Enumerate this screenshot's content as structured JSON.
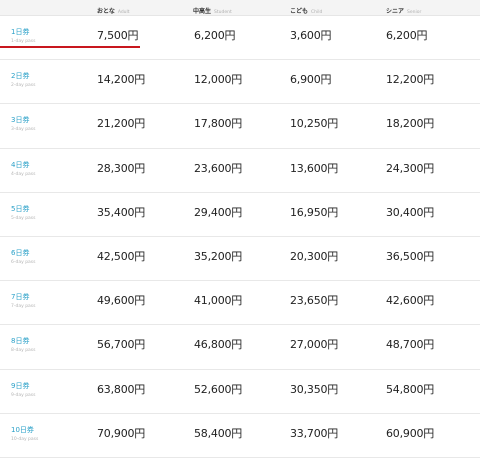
{
  "header": [
    {
      "jp": "おとな",
      "en": "Adult"
    },
    {
      "jp": "中高生",
      "en": "Student"
    },
    {
      "jp": "こども",
      "en": "Child"
    },
    {
      "jp": "シニア",
      "en": "Senior"
    }
  ],
  "rows": [
    {
      "pass": "1日券",
      "pass_en": "1-day pass",
      "adult": "7,500円",
      "student": "6,200円",
      "child": "3,600円",
      "senior": "6,200円",
      "selected": true
    },
    {
      "pass": "2日券",
      "pass_en": "2-day pass",
      "adult": "14,200円",
      "student": "12,000円",
      "child": "6,900円",
      "senior": "12,200円"
    },
    {
      "pass": "3日券",
      "pass_en": "3-day pass",
      "adult": "21,200円",
      "student": "17,800円",
      "child": "10,250円",
      "senior": "18,200円"
    },
    {
      "pass": "4日券",
      "pass_en": "4-day pass",
      "adult": "28,300円",
      "student": "23,600円",
      "child": "13,600円",
      "senior": "24,300円"
    },
    {
      "pass": "5日券",
      "pass_en": "5-day pass",
      "adult": "35,400円",
      "student": "29,400円",
      "child": "16,950円",
      "senior": "30,400円"
    },
    {
      "pass": "6日券",
      "pass_en": "6-day pass",
      "adult": "42,500円",
      "student": "35,200円",
      "child": "20,300円",
      "senior": "36,500円"
    },
    {
      "pass": "7日券",
      "pass_en": "7-day pass",
      "adult": "49,600円",
      "student": "41,000円",
      "child": "23,650円",
      "senior": "42,600円"
    },
    {
      "pass": "8日券",
      "pass_en": "8-day pass",
      "adult": "56,700円",
      "student": "46,800円",
      "child": "27,000円",
      "senior": "48,700円"
    },
    {
      "pass": "9日券",
      "pass_en": "9-day pass",
      "adult": "63,800円",
      "student": "52,600円",
      "child": "30,350円",
      "senior": "54,800円"
    },
    {
      "pass": "10日券",
      "pass_en": "10-day pass",
      "adult": "70,900円",
      "student": "58,400円",
      "child": "33,700円",
      "senior": "60,900円"
    }
  ],
  "colors": {
    "accent_underline": "#c8171e",
    "link": "#2aa0c8",
    "header_bg": "#f4f4f4"
  }
}
